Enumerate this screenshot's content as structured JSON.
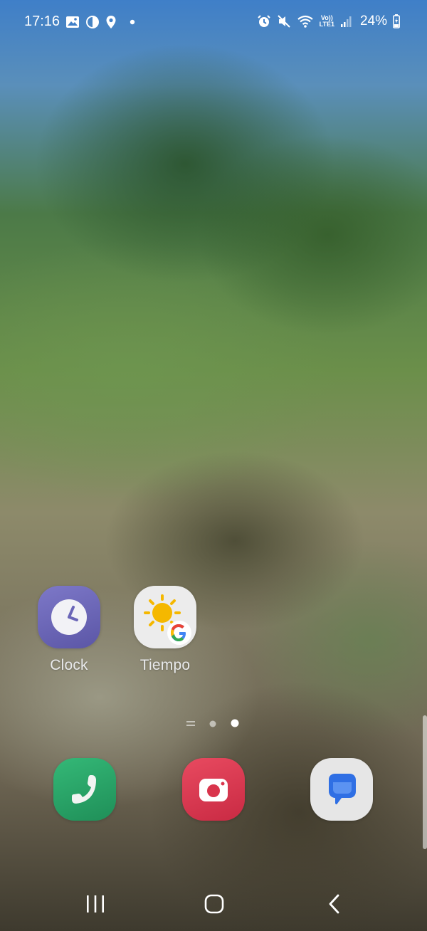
{
  "status_bar": {
    "time": "17:16",
    "left_icons": [
      "gallery-icon",
      "dnd-moon-icon",
      "location-icon",
      "dot-icon"
    ],
    "right_icons": [
      "alarm-icon",
      "mute-icon",
      "wifi-icon",
      "volte-lte-icon",
      "signal-icon"
    ],
    "volte_top": "Vo))",
    "volte_bottom": "LTE1",
    "battery": "24%",
    "battery_icon": "battery-charging-icon"
  },
  "home": {
    "apps": [
      {
        "label": "Clock",
        "icon": "clock-icon",
        "color": "#6b66b8"
      },
      {
        "label": "Tiempo",
        "icon": "weather-google-icon",
        "color": "#ececec"
      }
    ],
    "page_indicator": {
      "pages": 3,
      "current_page": 3,
      "first_is_home": true
    }
  },
  "dock": {
    "apps": [
      {
        "icon": "phone-icon",
        "color": "#28a265"
      },
      {
        "icon": "camera-icon",
        "color": "#d9344c"
      },
      {
        "icon": "messages-icon",
        "color": "#e6e6e6"
      }
    ]
  },
  "nav": {
    "recents": "recents-icon",
    "home": "home-icon",
    "back": "back-icon"
  }
}
